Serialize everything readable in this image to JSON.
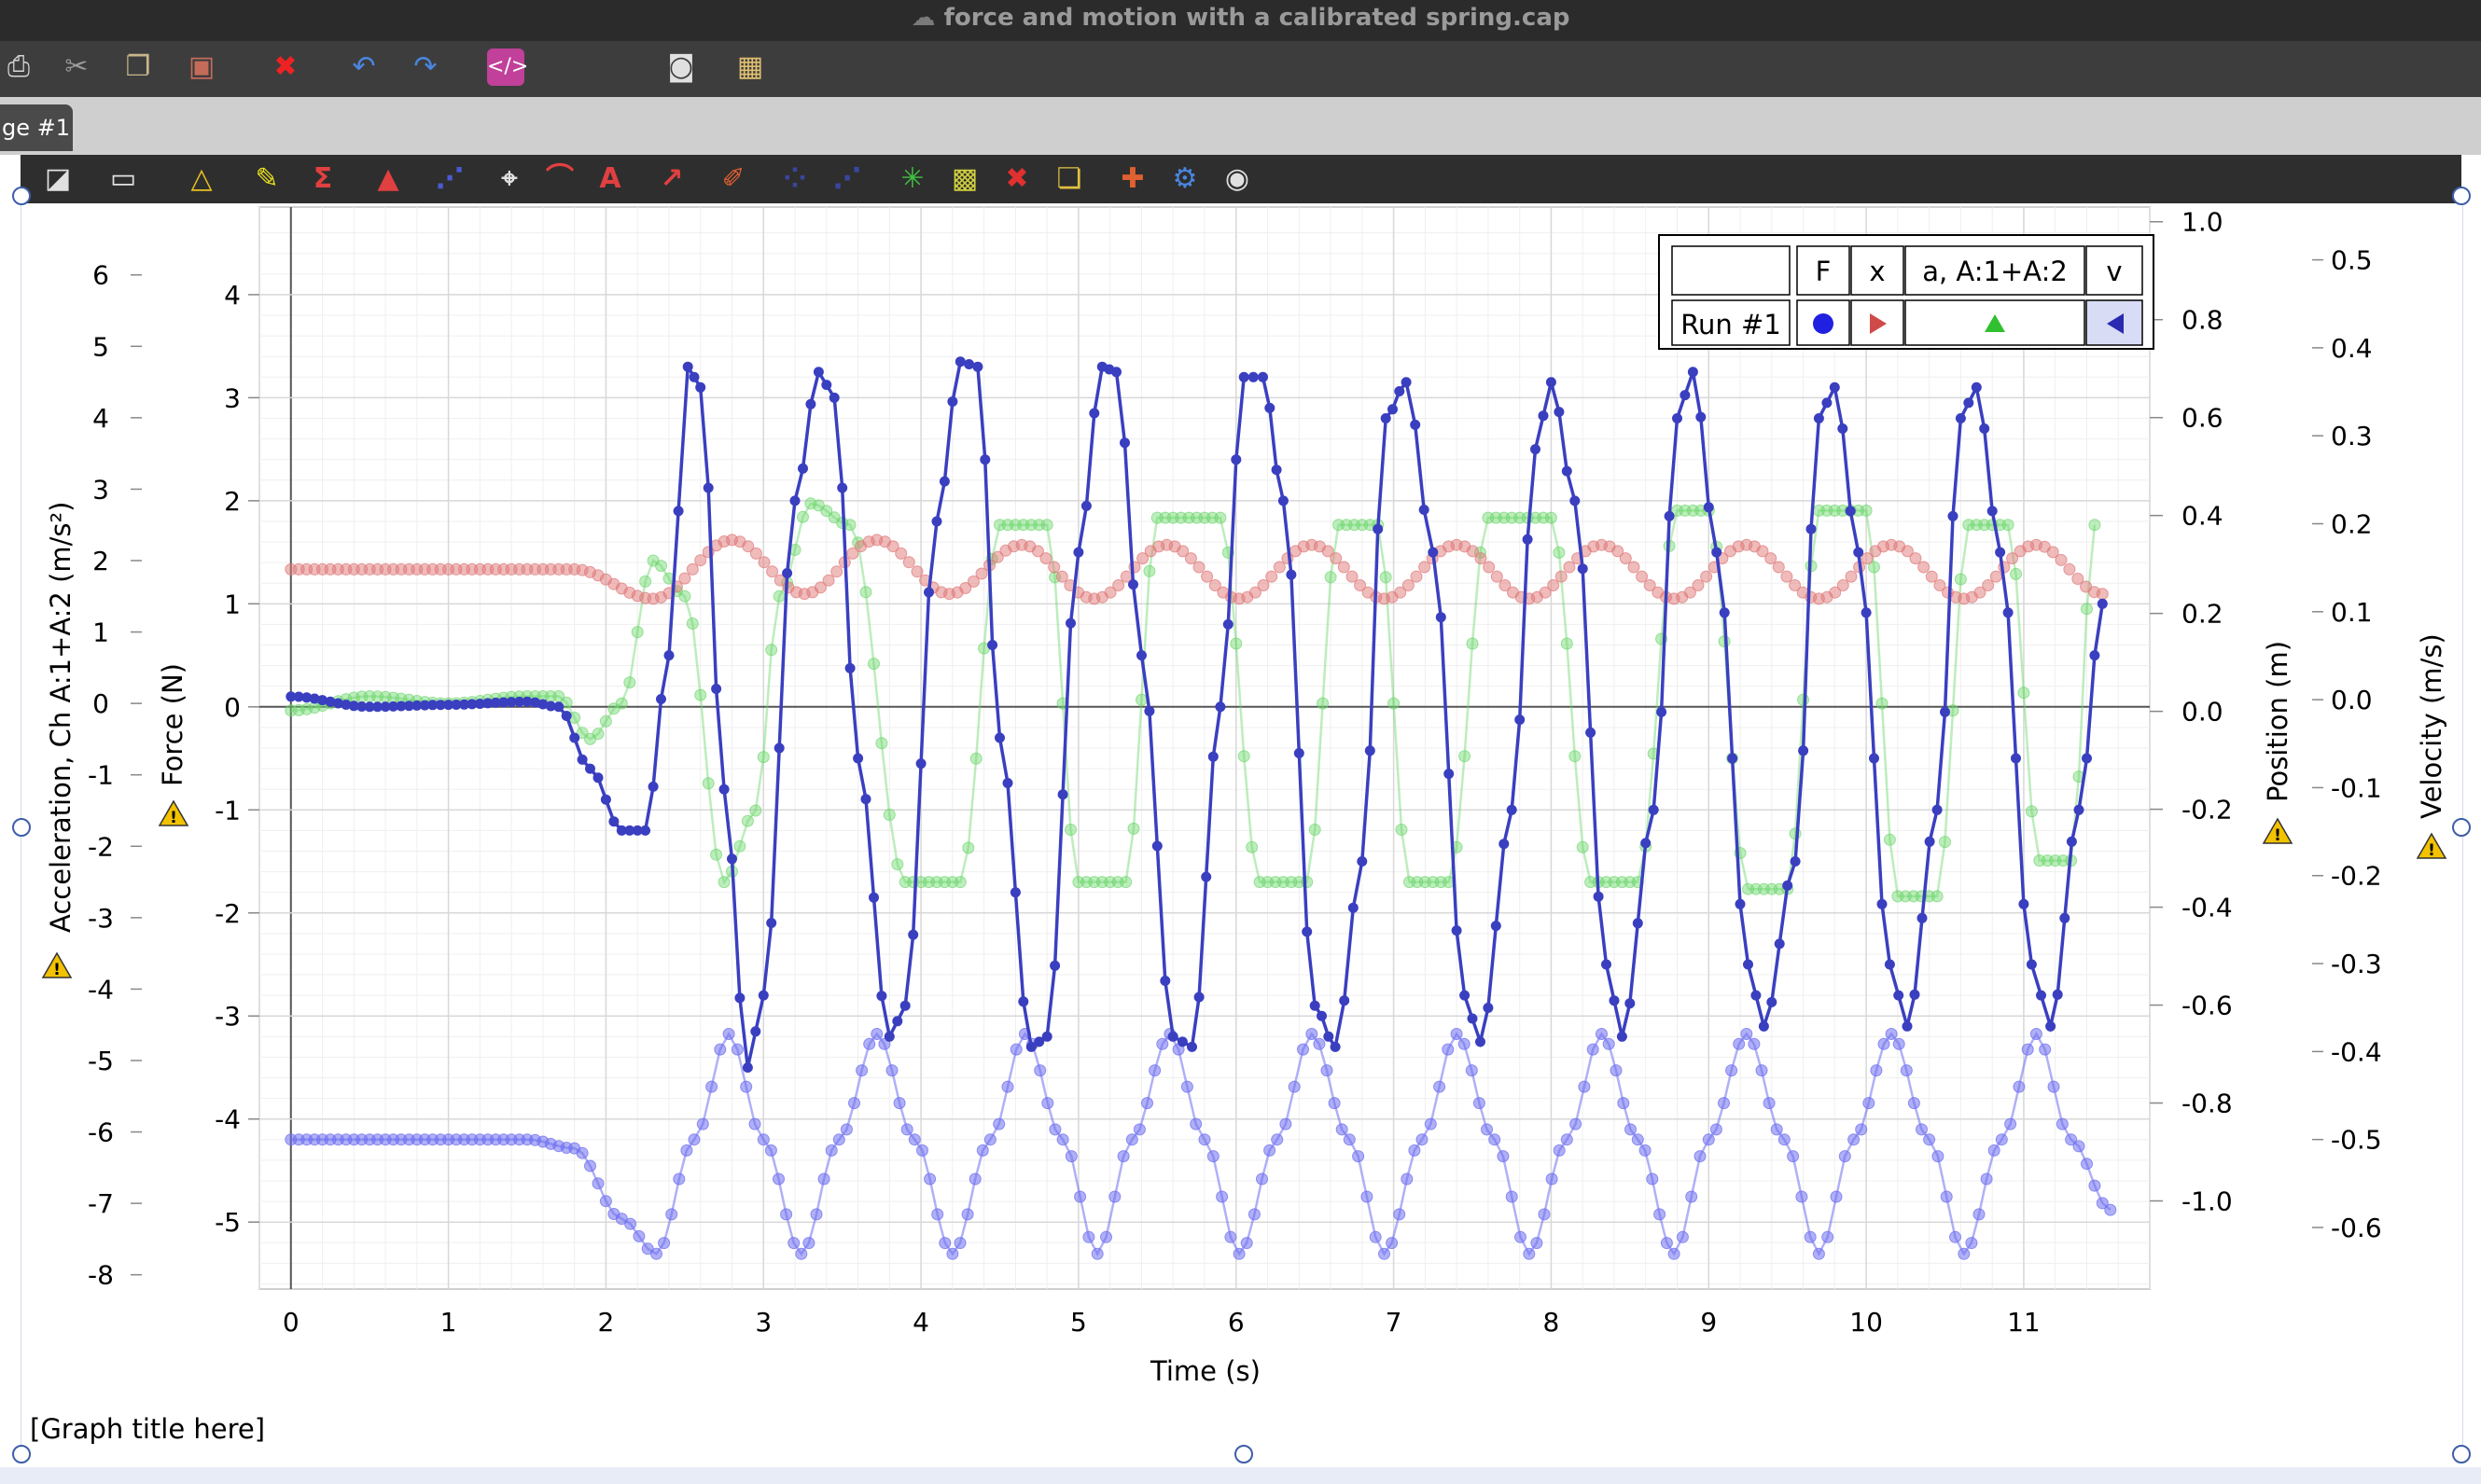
{
  "window": {
    "title": "force and motion with a calibrated spring.cap"
  },
  "toolbar_icons": [
    "print-icon",
    "cut-icon",
    "copy-icon",
    "paste-icon",
    "delete-page-icon",
    "undo-icon",
    "redo-icon",
    "embed-code-icon",
    "camera-icon",
    "layout-icon"
  ],
  "page_tab": {
    "label": "ge #1"
  },
  "graph_toolbar_icons": [
    "new-graph-icon",
    "save-graph-icon",
    "triangle-tool-icon",
    "pencil-icon",
    "sigma-icon",
    "area-icon",
    "curve-fit-icon",
    "crosshair-icon",
    "tangent-icon",
    "annotation-icon",
    "prediction-icon",
    "draw-icon",
    "select-icon",
    "select-2-icon",
    "autoscale-icon",
    "zoom-icon",
    "remove-icon",
    "copy-icon",
    "pin-icon",
    "settings-icon",
    "view-icon"
  ],
  "graph": {
    "title": "[Graph title here]"
  },
  "legend": {
    "header": [
      "",
      "F",
      "x",
      "a, A:1+A:2",
      "v"
    ],
    "run_label": "Run #1",
    "symbols": [
      "circle",
      "triangle-right",
      "triangle-up",
      "triangle-left"
    ]
  },
  "colors": {
    "force": "#3a3fc0",
    "position": "#e07878",
    "acceleration": "#6cd66c",
    "velocity": "#7070f0",
    "warning": "#f2c200"
  },
  "chart_data": {
    "type": "scatter",
    "xlabel": "Time (s)",
    "xlim": [
      -0.2,
      11.8
    ],
    "x_ticks": [
      "0",
      "1",
      "2",
      "3",
      "4",
      "5",
      "6",
      "7",
      "8",
      "9",
      "10",
      "11"
    ],
    "axes": {
      "force": {
        "label": "Force (N)",
        "lim": [
          -5.65,
          4.85
        ],
        "ticks": [
          "4",
          "3",
          "2",
          "1",
          "0",
          "-1",
          "-2",
          "-3",
          "-4",
          "-5"
        ]
      },
      "acceleration": {
        "label": "Acceleration, Ch A:1+A:2 (m/s²)",
        "lim": [
          -8.2,
          6.95
        ],
        "ticks": [
          "6",
          "5",
          "4",
          "3",
          "2",
          "1",
          "0",
          "-1",
          "-2",
          "-3",
          "-4",
          "-5",
          "-6",
          "-7",
          "-8"
        ]
      },
      "position": {
        "label": "Position (m)",
        "lim": [
          -1.18,
          1.03
        ],
        "ticks": [
          "1.0",
          "0.8",
          "0.6",
          "0.4",
          "0.2",
          "0.0",
          "-0.2",
          "-0.4",
          "-0.6",
          "-0.8",
          "-1.0"
        ]
      },
      "velocity": {
        "label": "Velocity (m/s)",
        "lim": [
          -0.67,
          0.56
        ],
        "ticks": [
          "0.5",
          "0.4",
          "0.3",
          "0.2",
          "0.1",
          "0.0",
          "-0.1",
          "-0.2",
          "-0.3",
          "-0.4",
          "-0.5",
          "-0.6"
        ]
      }
    },
    "series": [
      {
        "name": "F",
        "axis": "force",
        "marker": "circle",
        "connected": true,
        "t": [
          0,
          0.5,
          1,
          1.5,
          1.7,
          1.9,
          2.1,
          2.25,
          2.4,
          2.52,
          2.6,
          2.75,
          2.9,
          3.0,
          3.2,
          3.35,
          3.45,
          3.6,
          3.8,
          3.9,
          4.1,
          4.25,
          4.36,
          4.5,
          4.7,
          4.8,
          5.0,
          5.15,
          5.24,
          5.4,
          5.6,
          5.72,
          5.9,
          6.05,
          6.17,
          6.3,
          6.5,
          6.63,
          6.8,
          6.95,
          7.08,
          7.25,
          7.45,
          7.55,
          7.75,
          7.9,
          8.0,
          8.15,
          8.35,
          8.45,
          8.65,
          8.8,
          8.9,
          9.05,
          9.25,
          9.35,
          9.55,
          9.7,
          9.8,
          9.95,
          10.15,
          10.26,
          10.45,
          10.6,
          10.7,
          10.85,
          11.05,
          11.17,
          11.35,
          11.5
        ],
        "v": [
          0.1,
          0,
          0.02,
          0.05,
          0,
          -0.6,
          -1.2,
          -1.2,
          0.5,
          3.3,
          3.1,
          -0.8,
          -3.5,
          -2.8,
          2,
          3.25,
          3,
          -0.5,
          -3.2,
          -2.9,
          1.8,
          3.35,
          3.3,
          -0.3,
          -3.3,
          -3.2,
          1.5,
          3.3,
          3.25,
          0.5,
          -3.2,
          -3.3,
          0,
          3.2,
          3.2,
          2,
          -2.9,
          -3.3,
          -1.5,
          2.8,
          3.15,
          1.5,
          -2.8,
          -3.25,
          -1,
          2.5,
          3.15,
          2,
          -2.5,
          -3.2,
          -1,
          2.8,
          3.25,
          1.5,
          -2.5,
          -3.1,
          -1.5,
          2.8,
          3.1,
          1.5,
          -2.5,
          -3.1,
          -1,
          2.8,
          3.1,
          1.5,
          -2.5,
          -3.1,
          -1,
          1.0
        ]
      },
      {
        "name": "x",
        "axis": "position",
        "marker": "triangle-right",
        "connected": false,
        "t": [
          0,
          1.8,
          2.3,
          2.8,
          3.26,
          3.72,
          4.18,
          4.64,
          5.1,
          5.56,
          6.02,
          6.48,
          6.94,
          7.4,
          7.86,
          8.32,
          8.78,
          9.24,
          9.7,
          10.16,
          10.62,
          11.08,
          11.5
        ],
        "v": [
          0.29,
          0.29,
          0.23,
          0.35,
          0.24,
          0.35,
          0.24,
          0.34,
          0.23,
          0.34,
          0.23,
          0.34,
          0.23,
          0.34,
          0.23,
          0.34,
          0.23,
          0.34,
          0.23,
          0.34,
          0.23,
          0.34,
          0.24
        ]
      },
      {
        "name": "a, A:1+A:2",
        "axis": "acceleration",
        "marker": "triangle-up",
        "connected": false,
        "t": [
          0,
          0.5,
          1,
          1.5,
          1.7,
          1.9,
          2.1,
          2.3,
          2.5,
          2.75,
          2.95,
          3.1,
          3.3,
          3.55,
          3.9,
          4.25,
          4.5,
          4.8,
          5.0,
          5.3,
          5.5,
          5.9,
          6.15,
          6.45,
          6.65,
          6.9,
          7.1,
          7.35,
          7.6,
          8.0,
          8.25,
          8.55,
          8.8,
          9.0,
          9.25,
          9.5,
          9.7,
          10.0,
          10.2,
          10.45,
          10.65,
          10.9,
          11.1,
          11.3,
          11.45
        ],
        "v": [
          -0.1,
          0.1,
          0,
          0.1,
          0.1,
          -0.5,
          0,
          2,
          1.5,
          -2.5,
          -1.5,
          1.5,
          2.8,
          2.5,
          -2.5,
          -2.5,
          2.5,
          2.5,
          -2.5,
          -2.5,
          2.6,
          2.6,
          -2.5,
          -2.5,
          2.5,
          2.5,
          -2.5,
          -2.5,
          2.6,
          2.6,
          -2.5,
          -2.5,
          2.7,
          2.7,
          -2.6,
          -2.6,
          2.7,
          2.7,
          -2.7,
          -2.7,
          2.5,
          2.5,
          -2.2,
          -2.2,
          2.5
        ]
      },
      {
        "name": "v",
        "axis": "velocity",
        "marker": "triangle-left",
        "connected": false,
        "t": [
          0,
          0.5,
          1,
          1.5,
          1.8,
          2.1,
          2.32,
          2.56,
          2.78,
          3.0,
          3.24,
          3.48,
          3.72,
          3.96,
          4.2,
          4.44,
          4.66,
          4.9,
          5.12,
          5.34,
          5.58,
          5.8,
          6.02,
          6.26,
          6.48,
          6.72,
          6.94,
          7.18,
          7.4,
          7.64,
          7.86,
          8.1,
          8.32,
          8.55,
          8.78,
          9.0,
          9.24,
          9.48,
          9.7,
          9.92,
          10.16,
          10.4,
          10.62,
          10.86,
          11.08,
          11.3,
          11.55
        ],
        "v": [
          -0.5,
          -0.5,
          -0.5,
          -0.5,
          -0.51,
          -0.59,
          -0.63,
          -0.5,
          -0.38,
          -0.5,
          -0.63,
          -0.5,
          -0.38,
          -0.5,
          -0.63,
          -0.5,
          -0.38,
          -0.5,
          -0.63,
          -0.5,
          -0.38,
          -0.5,
          -0.63,
          -0.5,
          -0.38,
          -0.5,
          -0.63,
          -0.5,
          -0.38,
          -0.5,
          -0.63,
          -0.5,
          -0.38,
          -0.5,
          -0.63,
          -0.5,
          -0.38,
          -0.5,
          -0.63,
          -0.5,
          -0.38,
          -0.5,
          -0.63,
          -0.5,
          -0.38,
          -0.5,
          -0.58
        ]
      }
    ]
  }
}
